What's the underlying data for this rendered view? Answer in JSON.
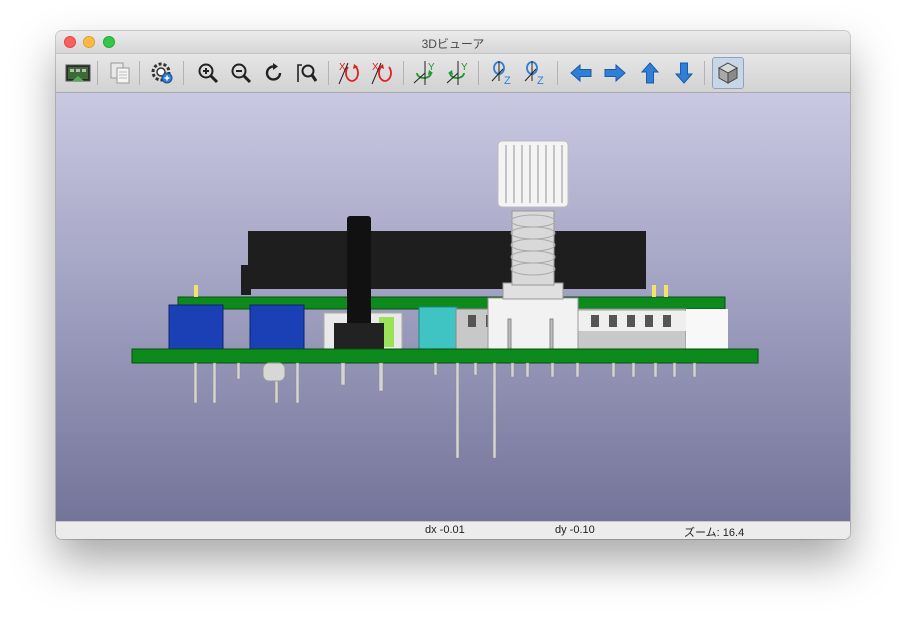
{
  "window": {
    "title": "3Dビューア"
  },
  "toolbar": {
    "buttons": [
      {
        "name": "render-icon",
        "tooltip": ""
      },
      {
        "name": "copy-icon",
        "tooltip": ""
      },
      {
        "name": "settings-icon",
        "tooltip": ""
      },
      {
        "name": "zoom-in-icon",
        "tooltip": ""
      },
      {
        "name": "zoom-out-icon",
        "tooltip": ""
      },
      {
        "name": "refresh-icon",
        "tooltip": ""
      },
      {
        "name": "zoom-fit-icon",
        "tooltip": ""
      },
      {
        "name": "rotate-x-cw-icon",
        "label": "X"
      },
      {
        "name": "rotate-x-ccw-icon",
        "label": "X"
      },
      {
        "name": "rotate-y-cw-icon",
        "label": "Y"
      },
      {
        "name": "rotate-y-ccw-icon",
        "label": "Y"
      },
      {
        "name": "rotate-z-cw-icon",
        "label": "Z"
      },
      {
        "name": "rotate-z-ccw-icon",
        "label": "Z"
      },
      {
        "name": "arrow-left-icon"
      },
      {
        "name": "arrow-right-icon"
      },
      {
        "name": "arrow-up-icon"
      },
      {
        "name": "arrow-down-icon"
      },
      {
        "name": "orthographic-cube-icon",
        "active": true
      }
    ]
  },
  "status": {
    "dx": "dx -0.01",
    "dy": "dy -0.10",
    "zoom": "ズーム: 16.4"
  },
  "colors": {
    "pcb_green": "#0d8a1c",
    "chassis_black": "#1e1e1e",
    "connector_blue": "#1b3fb5",
    "accent_blue": "#2f7fd6",
    "rotate_red": "#e02020",
    "rotate_green": "#1a9a2a"
  }
}
